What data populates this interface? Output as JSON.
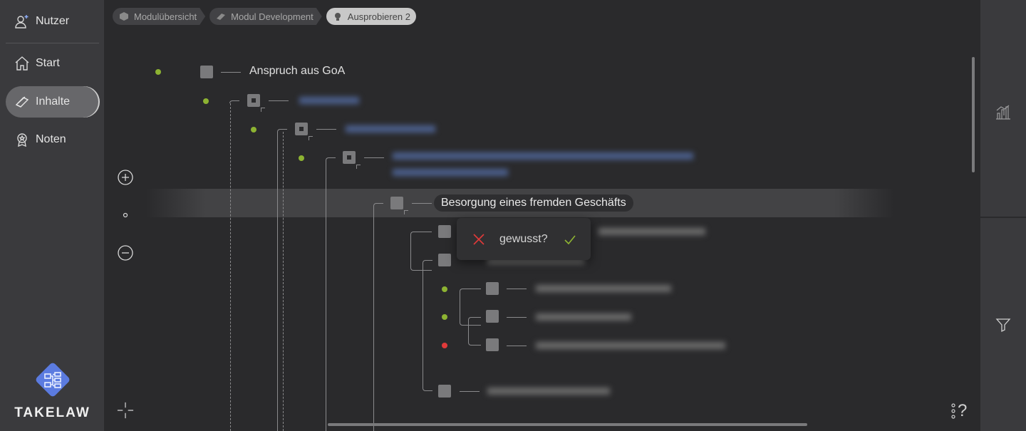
{
  "sidebar": {
    "items": [
      {
        "label": "Nutzer",
        "icon": "user-plus-icon"
      },
      {
        "label": "Start",
        "icon": "home-icon"
      },
      {
        "label": "Inhalte",
        "icon": "book-icon"
      },
      {
        "label": "Noten",
        "icon": "award-icon"
      }
    ],
    "active": "Inhalte"
  },
  "logo": {
    "text": "TAKELAW",
    "color": "#5b7be0"
  },
  "breadcrumb": [
    {
      "label": "Modulübersicht",
      "icon": "box-icon"
    },
    {
      "label": "Modul Development",
      "icon": "book-icon"
    },
    {
      "label": "Ausprobieren 2",
      "icon": "lightbulb-icon"
    }
  ],
  "tree": {
    "root_label": "Anspruch aus GoA",
    "focused_label": "Besorgung eines fremden Geschäfts"
  },
  "popup": {
    "question": "gewusst?",
    "no_color": "#e03a3a",
    "yes_color": "#8db332"
  },
  "status_colors": {
    "known": "#8db332",
    "unknown": "#e03a3a"
  },
  "footer": {
    "help": "?"
  }
}
